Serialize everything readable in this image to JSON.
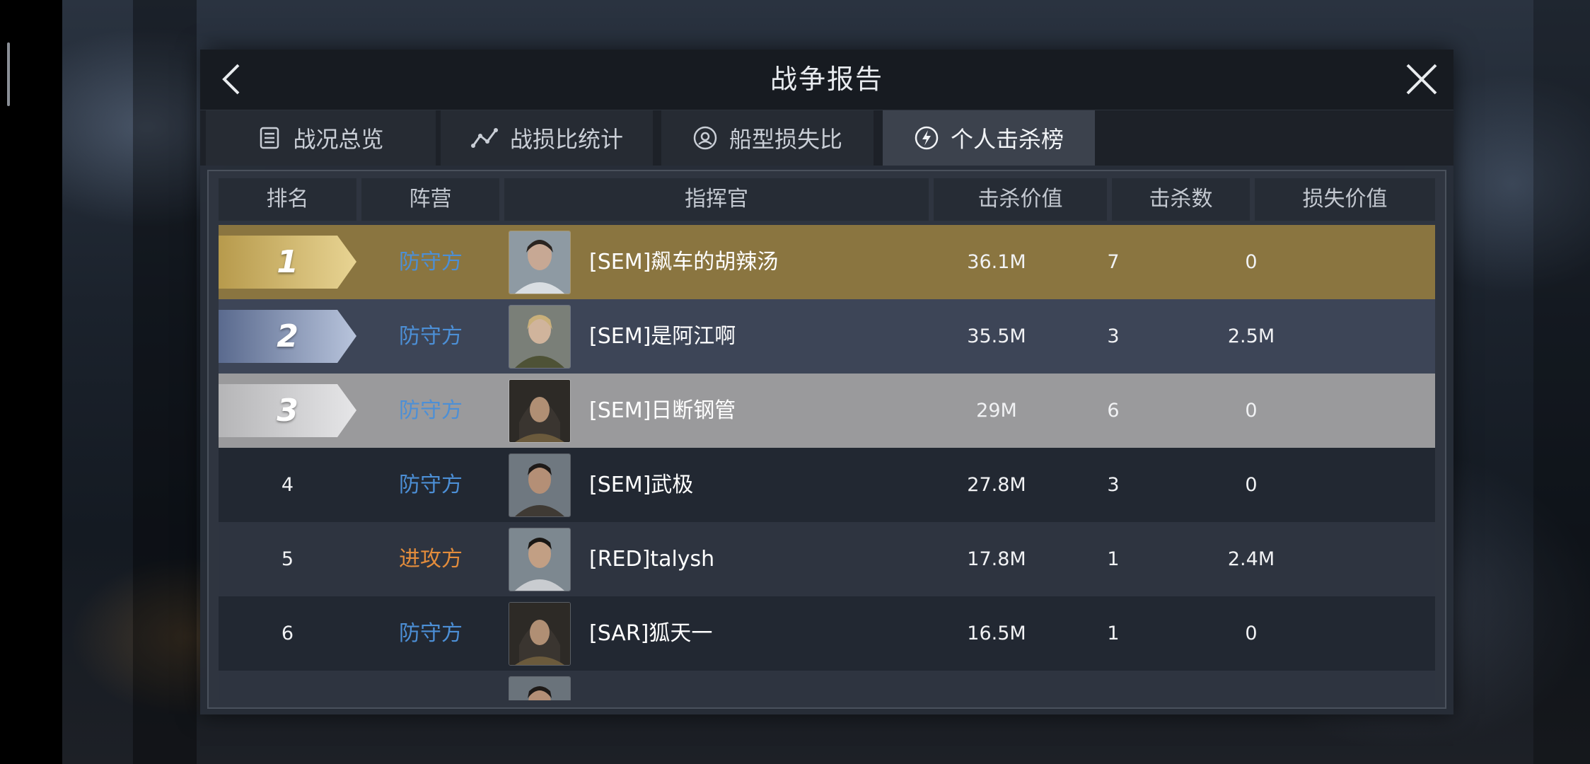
{
  "window": {
    "title": "战争报告"
  },
  "colors": {
    "defender": "#4c8fd6",
    "attacker": "#e38c3b",
    "rank1_row": "#8a7540",
    "rank2_row": "#3d4557",
    "rank3_row": "#9a9a9c",
    "row_dark": "#222832",
    "row_mid": "#2e3440"
  },
  "tabs": [
    {
      "label": "战况总览",
      "icon": "document-list-icon"
    },
    {
      "label": "战损比统计",
      "icon": "line-chart-icon"
    },
    {
      "label": "船型损失比",
      "icon": "ship-ring-icon"
    },
    {
      "label": "个人击杀榜",
      "icon": "lightning-circle-icon",
      "active": true
    }
  ],
  "table": {
    "headers": {
      "rank": "排名",
      "faction": "阵营",
      "commander": "指挥官",
      "kill_value": "击杀价值",
      "kills": "击杀数",
      "loss_value": "损失价值"
    },
    "rows": [
      {
        "rank": "1",
        "faction": "防守方",
        "side": "defender",
        "name": "[SEM]飙车的胡辣汤",
        "kill_value": "36.1M",
        "kills": "7",
        "loss_value": "0"
      },
      {
        "rank": "2",
        "faction": "防守方",
        "side": "defender",
        "name": "[SEM]是阿江啊",
        "kill_value": "35.5M",
        "kills": "3",
        "loss_value": "2.5M"
      },
      {
        "rank": "3",
        "faction": "防守方",
        "side": "defender",
        "name": "[SEM]日断钢管",
        "kill_value": "29M",
        "kills": "6",
        "loss_value": "0"
      },
      {
        "rank": "4",
        "faction": "防守方",
        "side": "defender",
        "name": "[SEM]武极",
        "kill_value": "27.8M",
        "kills": "3",
        "loss_value": "0"
      },
      {
        "rank": "5",
        "faction": "进攻方",
        "side": "attacker",
        "name": "[RED]talysh",
        "kill_value": "17.8M",
        "kills": "1",
        "loss_value": "2.4M"
      },
      {
        "rank": "6",
        "faction": "防守方",
        "side": "defender",
        "name": "[SAR]狐天一",
        "kill_value": "16.5M",
        "kills": "1",
        "loss_value": "0"
      }
    ]
  }
}
